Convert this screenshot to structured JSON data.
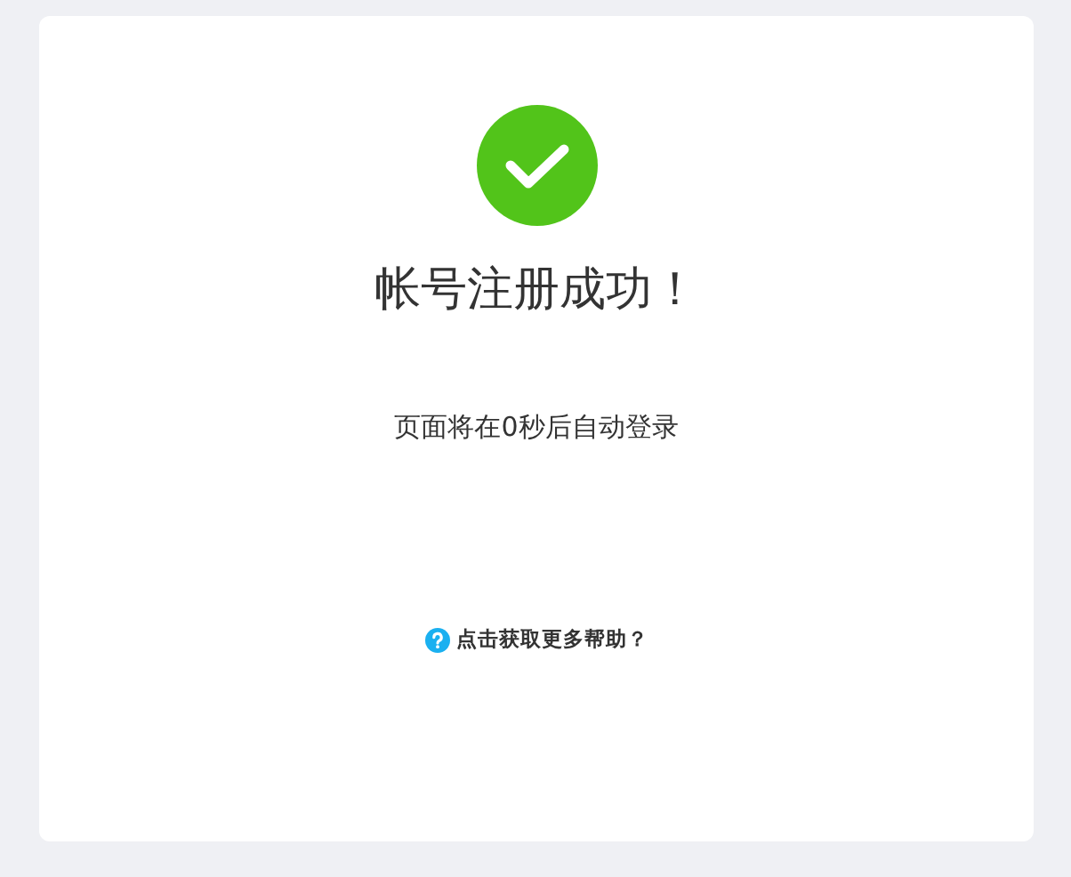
{
  "result": {
    "kind": "success",
    "title": "帐号注册成功！",
    "message": "页面将在0秒后自动登录"
  },
  "help_link": {
    "label": "点击获取更多帮助？"
  }
}
